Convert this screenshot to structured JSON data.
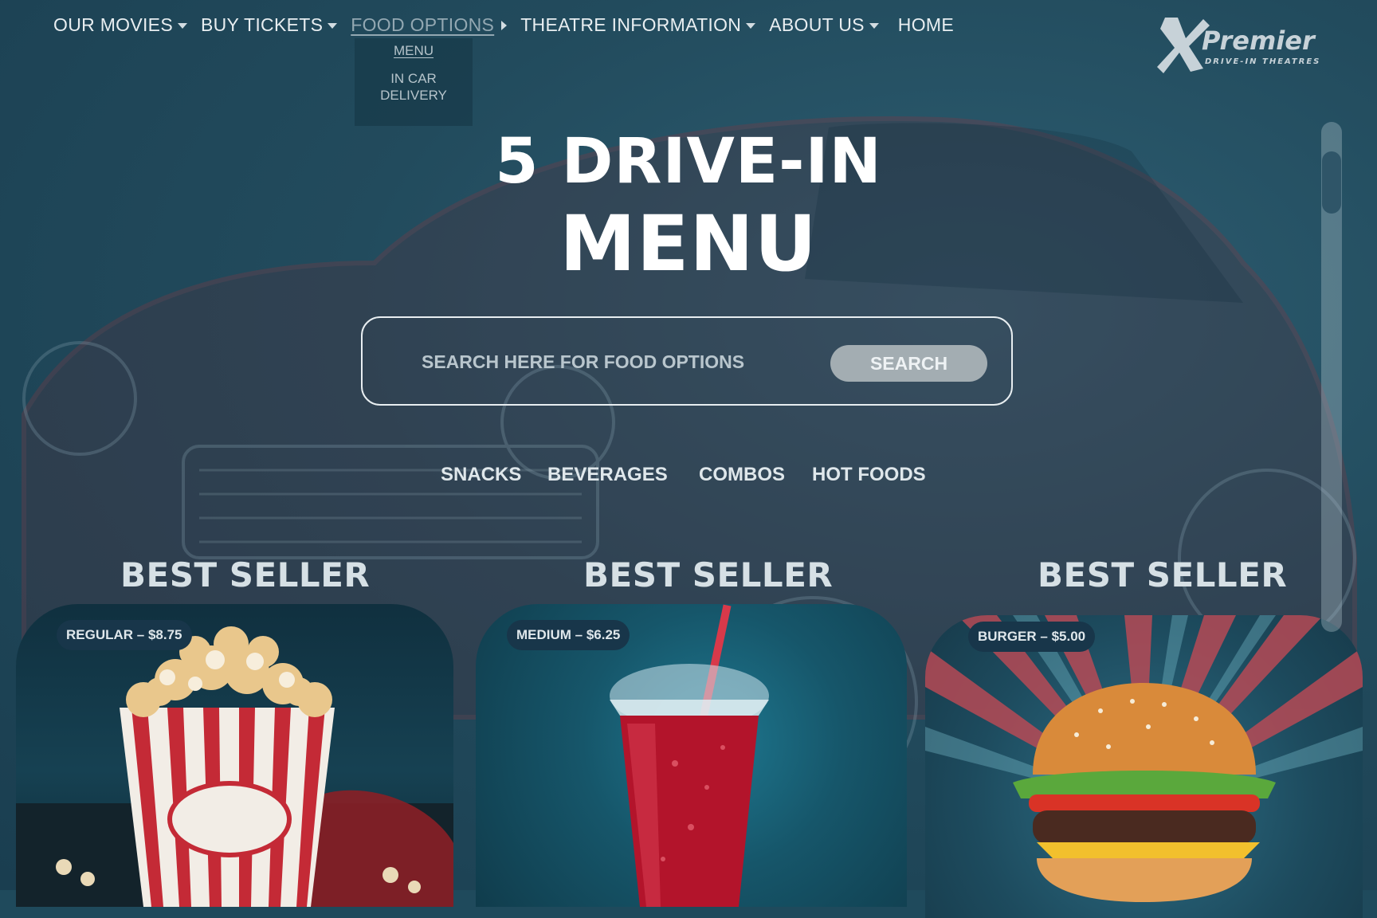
{
  "nav": {
    "items": [
      {
        "label": "OUR MOVIES",
        "has_dropdown": true
      },
      {
        "label": "BUY TICKETS",
        "has_dropdown": true
      },
      {
        "label": "FOOD OPTIONS",
        "has_dropdown": true,
        "active": true
      },
      {
        "label": "THEATRE INFORMATION",
        "has_dropdown": true
      },
      {
        "label": "ABOUT US",
        "has_dropdown": true
      },
      {
        "label": "HOME",
        "has_dropdown": false
      }
    ],
    "food_dropdown": [
      "MENU",
      "IN CAR DELIVERY"
    ]
  },
  "logo": {
    "name": "Premier",
    "tagline": "DRIVE-IN THEATRES"
  },
  "hero": {
    "title_line1": "5 DRIVE-IN",
    "title_line2": "MENU"
  },
  "search": {
    "placeholder": "SEARCH HERE FOR FOOD OPTIONS",
    "button_label": "SEARCH"
  },
  "categories": [
    "SNACKS",
    "BEVERAGES",
    "COMBOS",
    "HOT FOODS"
  ],
  "cards": [
    {
      "heading": "BEST SELLER",
      "price_label": "REGULAR – $8.75",
      "image": "popcorn-bucket"
    },
    {
      "heading": "BEST SELLER",
      "price_label": "MEDIUM – $6.25",
      "image": "red-soda-cup"
    },
    {
      "heading": "BEST SELLER",
      "price_label": "BURGER – $5.00",
      "image": "cheeseburger"
    }
  ],
  "colors": {
    "background": "#224b5d",
    "text": "#e8eef1",
    "accent_red": "#c42a36",
    "search_button": "#a3adb2"
  }
}
